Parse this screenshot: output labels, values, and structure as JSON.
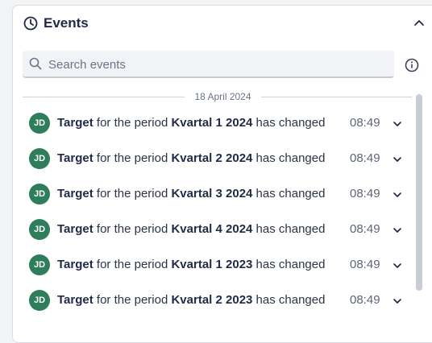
{
  "panel": {
    "title": "Events",
    "icons": {
      "header": "clock-icon",
      "collapse": "chevron-up-icon",
      "search": "search-icon",
      "info": "info-icon",
      "expand": "chevron-down-icon"
    }
  },
  "search": {
    "placeholder": "Search events",
    "value": ""
  },
  "date_separator": "18 April 2024",
  "events": [
    {
      "initials": "JD",
      "subject": "Target",
      "middle": "for the period",
      "period": "Kvartal 1 2024",
      "suffix": "has changed",
      "time": "08:49"
    },
    {
      "initials": "JD",
      "subject": "Target",
      "middle": "for the period",
      "period": "Kvartal 2 2024",
      "suffix": "has changed",
      "time": "08:49"
    },
    {
      "initials": "JD",
      "subject": "Target",
      "middle": "for the period",
      "period": "Kvartal 3 2024",
      "suffix": "has changed",
      "time": "08:49"
    },
    {
      "initials": "JD",
      "subject": "Target",
      "middle": "for the period",
      "period": "Kvartal 4 2024",
      "suffix": "has changed",
      "time": "08:49"
    },
    {
      "initials": "JD",
      "subject": "Target",
      "middle": "for the period",
      "period": "Kvartal 1 2023",
      "suffix": "has changed",
      "time": "08:49"
    },
    {
      "initials": "JD",
      "subject": "Target",
      "middle": "for the period",
      "period": "Kvartal 2 2023",
      "suffix": "has changed",
      "time": "08:49"
    }
  ],
  "colors": {
    "avatar": "#2e7d5b",
    "title": "#1f2a44",
    "muted": "#6b7486"
  }
}
